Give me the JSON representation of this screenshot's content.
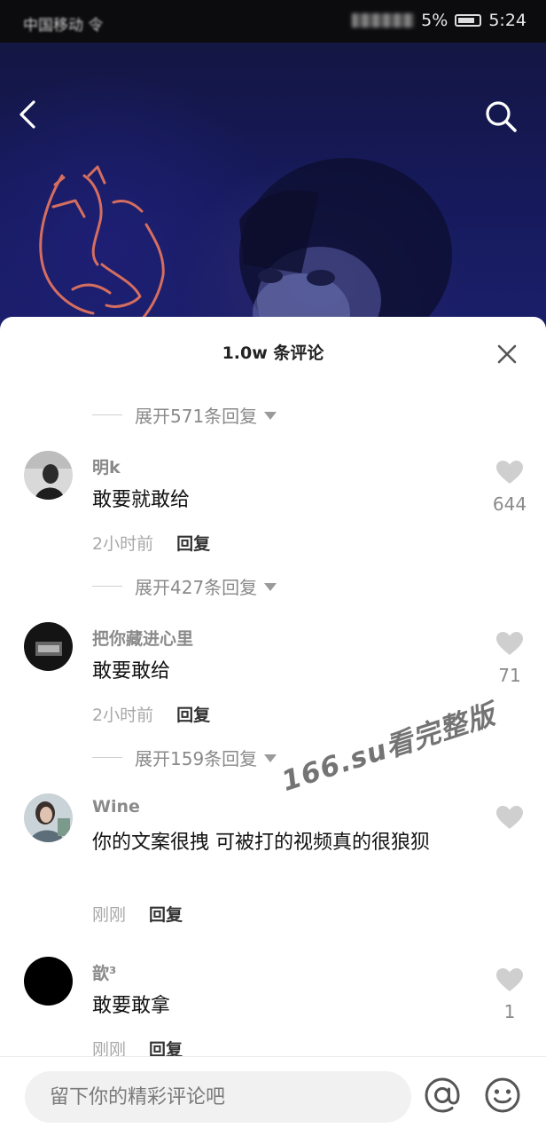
{
  "status_bar": {
    "carrier": "中国移动 令",
    "battery": "5%",
    "time": "5:24"
  },
  "video": {
    "back_icon": "chevron-left-icon",
    "search_icon": "search-icon"
  },
  "comments_panel": {
    "title": "1.0w 条评论",
    "close_icon": "close-icon",
    "expand_labels": [
      "展开571条回复",
      "展开427条回复",
      "展开159条回复"
    ],
    "comments": [
      {
        "user": "明k",
        "text": "敢要就敢给",
        "time": "2小时前",
        "reply": "回复",
        "likes": "644"
      },
      {
        "user": "把你藏进心里",
        "text": "敢要敢给",
        "time": "2小时前",
        "reply": "回复",
        "likes": "71"
      },
      {
        "user": "Wine",
        "text": "你的文案很拽 可被打的视频真的很狼狈",
        "time": "刚刚",
        "reply": "回复",
        "likes": ""
      },
      {
        "user": "歆³",
        "text": "敢要敢拿",
        "time": "刚刚",
        "reply": "回复",
        "likes": "1"
      }
    ]
  },
  "watermark": "166.su看完整版",
  "input_bar": {
    "placeholder": "留下你的精彩评论吧",
    "at_icon": "at-icon",
    "emoji_icon": "emoji-icon"
  },
  "colors": {
    "video_bg": "#161a5c",
    "sheet_bg": "#ffffff",
    "muted_text": "#8a8a8a",
    "heart": "#cfcfcf"
  }
}
